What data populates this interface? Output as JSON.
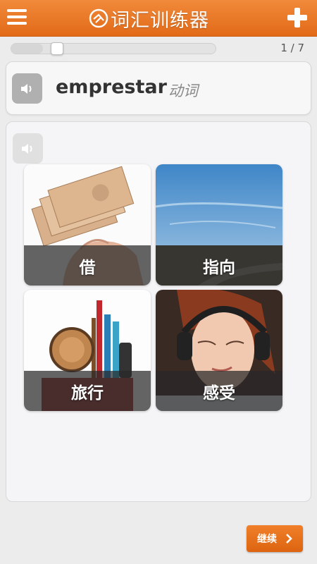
{
  "header": {
    "title": "词汇训练器",
    "menu_icon": "hamburger-menu-icon",
    "add_icon": "plus-icon",
    "logo_icon": "app-logo-icon",
    "color": "#e87a28"
  },
  "progress": {
    "label": "1 / 7",
    "current": 1,
    "total": 7,
    "fraction": 0.14
  },
  "word": {
    "text": "emprestar",
    "part_of_speech": "动词",
    "audio_icon": "speaker-icon"
  },
  "quiz": {
    "audio_icon": "speaker-icon",
    "options": [
      {
        "label": "借",
        "image": "money-in-hand"
      },
      {
        "label": "指向",
        "image": "road-landscape"
      },
      {
        "label": "旅行",
        "image": "travel-items"
      },
      {
        "label": "感受",
        "image": "woman-with-headphones"
      }
    ]
  },
  "footer": {
    "continue_label": "继续",
    "continue_icon": "chevron-right-icon"
  }
}
